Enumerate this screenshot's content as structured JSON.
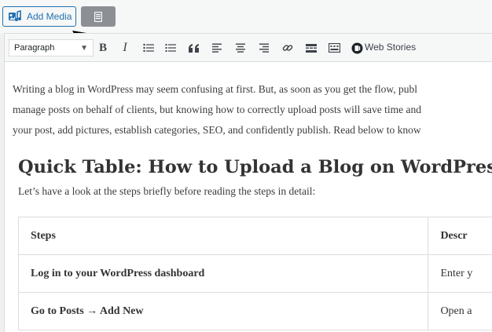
{
  "topbar": {
    "add_media_label": "Add Media"
  },
  "toolbar": {
    "format_select": "Paragraph",
    "bold_glyph": "B",
    "italic_glyph": "I",
    "web_stories_label": "Web Stories"
  },
  "content": {
    "intro_lines": [
      "Writing a blog in WordPress may seem confusing at first. But, as soon as you get the flow, publ",
      "manage posts on behalf of clients, but knowing how to correctly upload posts will save time and",
      "your post, add pictures, establish categories, SEO, and confidently publish. Read below to know"
    ],
    "heading": "Quick Table: How to Upload a Blog on WordPres",
    "subtext": "Let’s have a look at the steps briefly before reading the steps in detail:",
    "table": {
      "headers": [
        "Steps",
        "Descr"
      ],
      "rows": [
        [
          "Log in to your WordPress dashboard",
          "Enter y"
        ],
        [
          "Go to Posts → Add New",
          "Open a"
        ]
      ]
    }
  },
  "colors": {
    "accent": "#2271b1",
    "toolbar_bg": "#f6f7f7",
    "border": "#dcdcde"
  }
}
